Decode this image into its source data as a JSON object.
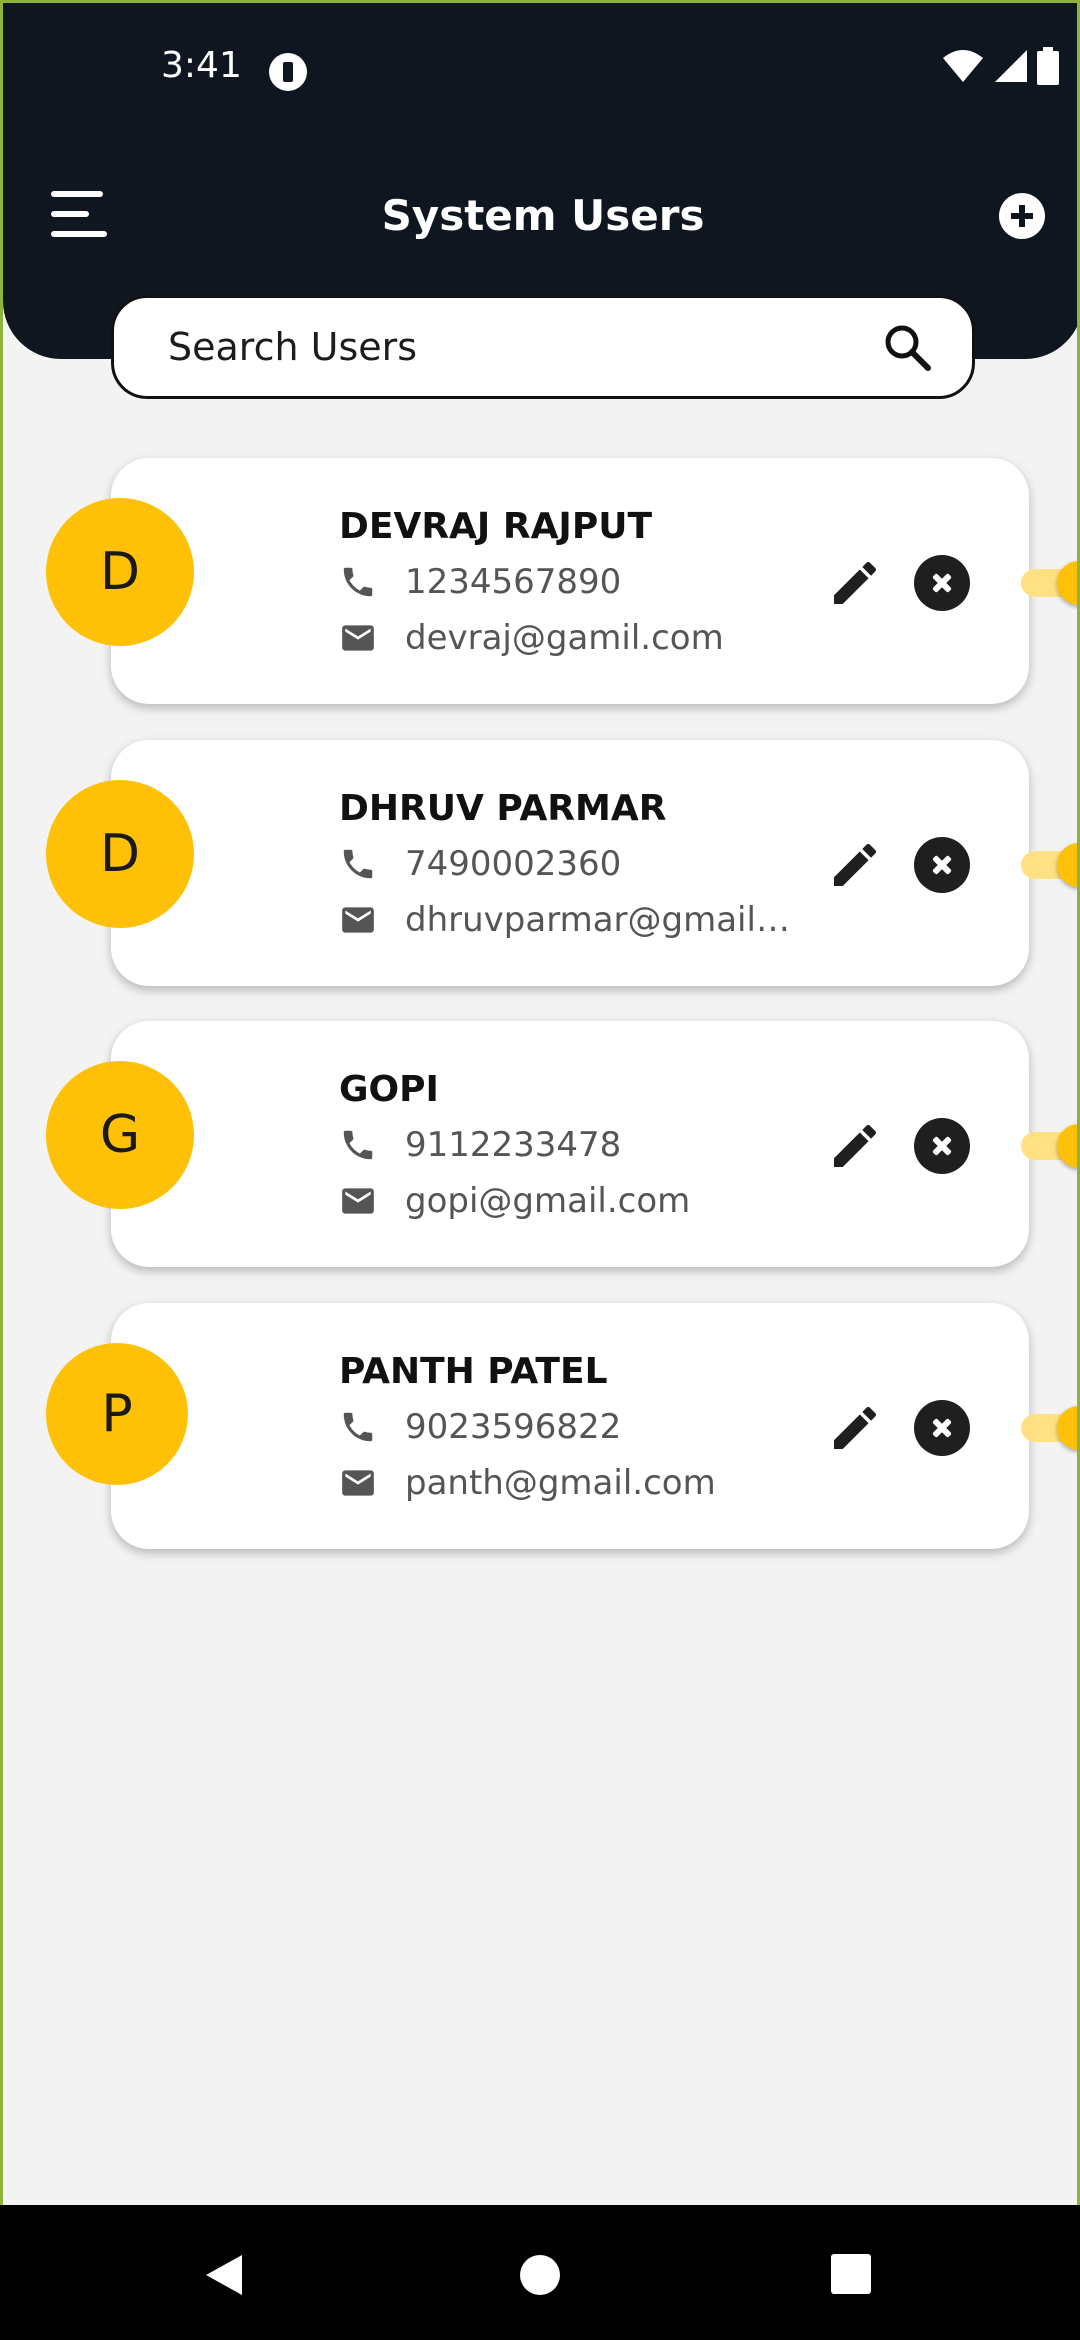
{
  "status_bar": {
    "time": "3:41"
  },
  "app_bar": {
    "title": "System Users"
  },
  "search": {
    "placeholder": "Search Users"
  },
  "users": [
    {
      "initial": "D",
      "name": "DEVRAJ RAJPUT",
      "phone": "1234567890",
      "email": "devraj@gamil.com",
      "enabled": true
    },
    {
      "initial": "D",
      "name": "DHRUV PARMAR",
      "phone": "7490002360",
      "email": "dhruvparmar@gmail....",
      "enabled": true
    },
    {
      "initial": "G",
      "name": "GOPI",
      "phone": "9112233478",
      "email": "gopi@gmail.com",
      "enabled": true
    },
    {
      "initial": "P",
      "name": "PANTH PATEL",
      "phone": "9023596822",
      "email": "panth@gmail.com",
      "enabled": true
    }
  ],
  "colors": {
    "header": "#10161f",
    "accent": "#ffc107",
    "background": "#f3f3f3"
  }
}
